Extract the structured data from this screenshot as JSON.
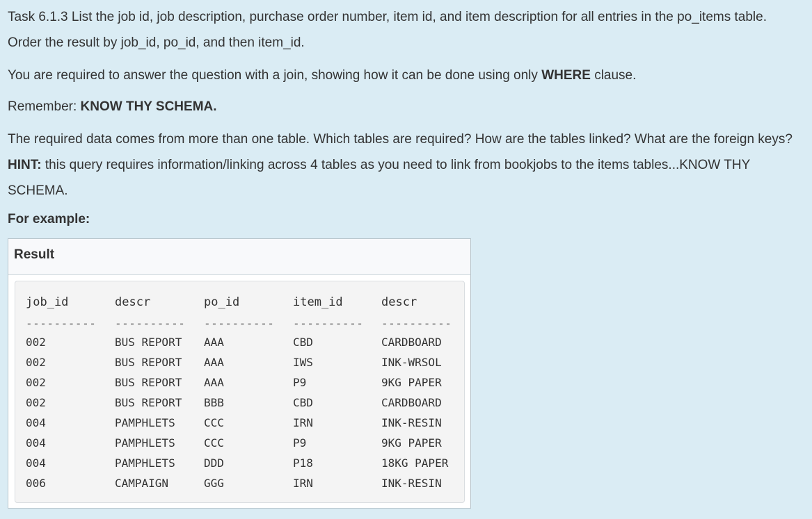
{
  "task": {
    "intro": "Task 6.1.3 List the job id, job description, purchase order number, item id, and item description for all entries in the po_items table. Order the result by job_id, po_id, and then item_id.",
    "requirement_prefix": "You are required to answer the question with a join, showing how it can be done using only ",
    "requirement_keyword": "WHERE",
    "requirement_suffix": " clause.",
    "remember_prefix": "Remember: ",
    "remember_keyword": "KNOW THY SCHEMA.",
    "hint_prefix": "The required data comes from more than one table.  Which tables are required? How are the tables linked? What are the foreign keys? ",
    "hint_keyword": "HINT:",
    "hint_suffix": " this query requires information/linking across 4 tables as you need to link from bookjobs to the items tables...KNOW THY SCHEMA.",
    "example_label": "For example:"
  },
  "result": {
    "title": "Result",
    "columns": [
      "job_id",
      "descr",
      "po_id",
      "item_id",
      "descr"
    ],
    "separator": "----------",
    "rows": [
      [
        "002",
        "BUS REPORT",
        "AAA",
        "CBD",
        "CARDBOARD"
      ],
      [
        "002",
        "BUS REPORT",
        "AAA",
        "IWS",
        "INK-WRSOL"
      ],
      [
        "002",
        "BUS REPORT",
        "AAA",
        "P9",
        "9KG PAPER"
      ],
      [
        "002",
        "BUS REPORT",
        "BBB",
        "CBD",
        "CARDBOARD"
      ],
      [
        "004",
        "PAMPHLETS",
        "CCC",
        "IRN",
        "INK-RESIN"
      ],
      [
        "004",
        "PAMPHLETS",
        "CCC",
        "P9",
        "9KG PAPER"
      ],
      [
        "004",
        "PAMPHLETS",
        "DDD",
        "P18",
        "18KG PAPER"
      ],
      [
        "006",
        "CAMPAIGN",
        "GGG",
        "IRN",
        "INK-RESIN"
      ]
    ]
  }
}
